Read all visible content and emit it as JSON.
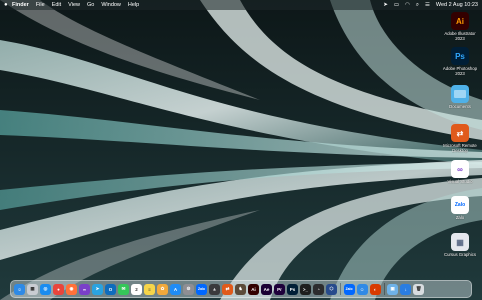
{
  "menubar": {
    "app_name": "Finder",
    "items": [
      "File",
      "Edit",
      "View",
      "Go",
      "Window",
      "Help"
    ],
    "clock": "Wed 2 Aug  10:23"
  },
  "desktop_icons": [
    {
      "label": "Adobe Illustrator 2023",
      "glyph": "Ai",
      "bg": "#330000",
      "fg": "#ff9a00"
    },
    {
      "label": "Adobe Photoshop 2023",
      "glyph": "Ps",
      "bg": "#001e36",
      "fg": "#31a8ff"
    },
    {
      "label": "Documents",
      "glyph": "",
      "bg": "#4fb1e8",
      "fg": "#ffffff"
    },
    {
      "label": "Microsoft Remote Desktop",
      "glyph": "⇄",
      "bg": "#e05a1b",
      "fg": "#ffffff"
    },
    {
      "label": "Visual Studio",
      "glyph": "∞",
      "bg": "#ffffff",
      "fg": "#7a3fc9"
    },
    {
      "label": "Zalo",
      "glyph": "Zalo",
      "bg": "#ffffff",
      "fg": "#0068ff"
    },
    {
      "label": "Cursus Graphics",
      "glyph": "▦",
      "bg": "#e5e8ee",
      "fg": "#5b6a86"
    }
  ],
  "dock": {
    "apps": [
      {
        "name": "finder",
        "glyph": "☺",
        "bg": "#2e8ae6"
      },
      {
        "name": "launchpad",
        "glyph": "▦",
        "bg": "#c9ccd2"
      },
      {
        "name": "safari",
        "glyph": "◎",
        "bg": "#1a8cf0"
      },
      {
        "name": "chrome",
        "glyph": "●",
        "bg": "#e8453c"
      },
      {
        "name": "firefox",
        "glyph": "◉",
        "bg": "#ff7139"
      },
      {
        "name": "visual-studio",
        "glyph": "∞",
        "bg": "#7a3fc9"
      },
      {
        "name": "telegram",
        "glyph": "➤",
        "bg": "#2aa3e0"
      },
      {
        "name": "outlook",
        "glyph": "O",
        "bg": "#0f6cbd"
      },
      {
        "name": "messages",
        "glyph": "✉",
        "bg": "#35c759"
      },
      {
        "name": "calendar",
        "glyph": "2",
        "bg": "#ffffff"
      },
      {
        "name": "notes",
        "glyph": "≡",
        "bg": "#f5d54a"
      },
      {
        "name": "photos",
        "glyph": "✿",
        "bg": "#f2a93b"
      },
      {
        "name": "app-store",
        "glyph": "A",
        "bg": "#1f8cf5"
      },
      {
        "name": "settings",
        "glyph": "⚙",
        "bg": "#8e8e93"
      },
      {
        "name": "zalo",
        "glyph": "Zalo",
        "bg": "#0068ff"
      },
      {
        "name": "calculator",
        "glyph": "±",
        "bg": "#3a3a3c"
      },
      {
        "name": "remote-desktop",
        "glyph": "⇄",
        "bg": "#e05a1b"
      },
      {
        "name": "chess",
        "glyph": "♞",
        "bg": "#5c4b3a"
      },
      {
        "name": "illustrator",
        "glyph": "Ai",
        "bg": "#330000"
      },
      {
        "name": "after-effects",
        "glyph": "Ae",
        "bg": "#1a0033"
      },
      {
        "name": "premiere",
        "glyph": "Pr",
        "bg": "#1e003a"
      },
      {
        "name": "photoshop",
        "glyph": "Ps",
        "bg": "#001e36"
      },
      {
        "name": "terminal",
        "glyph": ">_",
        "bg": "#1e1e1e"
      },
      {
        "name": "activity-monitor",
        "glyph": "◔",
        "bg": "#2c2c2e"
      },
      {
        "name": "vpn",
        "glyph": "⬡",
        "bg": "#274b8c"
      },
      {
        "name": "zalo-2",
        "glyph": "Zalo",
        "bg": "#0068ff"
      },
      {
        "name": "finder-2",
        "glyph": "☺",
        "bg": "#2e8ae6"
      },
      {
        "name": "office",
        "glyph": "◐",
        "bg": "#d83b01"
      },
      {
        "name": "preview",
        "glyph": "▣",
        "bg": "#6fb2e8"
      },
      {
        "name": "downloads",
        "glyph": "↓",
        "bg": "#2a7de1"
      },
      {
        "name": "trash",
        "glyph": "🗑",
        "bg": "#d8dce0"
      }
    ]
  }
}
